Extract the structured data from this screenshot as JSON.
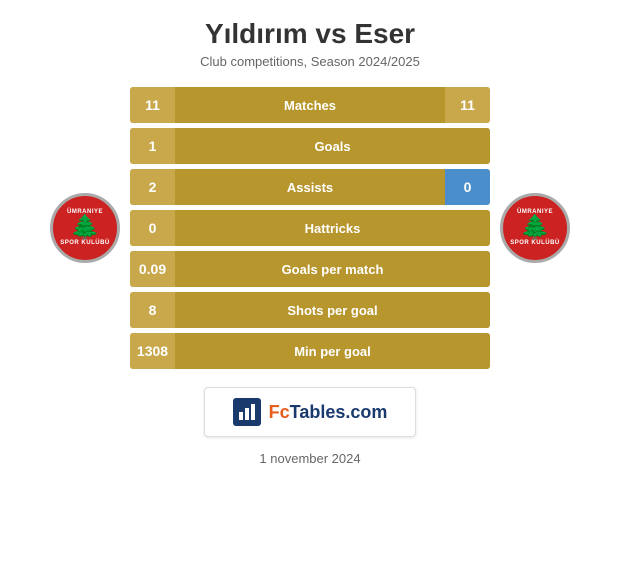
{
  "header": {
    "title": "Yıldırım vs Eser",
    "subtitle": "Club competitions, Season 2024/2025"
  },
  "stats": [
    {
      "label": "Matches",
      "left_val": "11",
      "right_val": "11",
      "type": "both"
    },
    {
      "label": "Goals",
      "left_val": "1",
      "right_val": "",
      "type": "left-only"
    },
    {
      "label": "Assists",
      "left_val": "2",
      "right_val": "0",
      "type": "assists"
    },
    {
      "label": "Hattricks",
      "left_val": "0",
      "right_val": "",
      "type": "left-only"
    },
    {
      "label": "Goals per match",
      "left_val": "0.09",
      "right_val": "",
      "type": "left-only"
    },
    {
      "label": "Shots per goal",
      "left_val": "8",
      "right_val": "",
      "type": "left-only"
    },
    {
      "label": "Min per goal",
      "left_val": "1308",
      "right_val": "",
      "type": "left-only"
    }
  ],
  "banner": {
    "text_fc": "Fc",
    "text_tables": "Tables.com"
  },
  "footer": {
    "date": "1 november 2024"
  },
  "logo_left_top": "ÜMRANIYE",
  "logo_left_bottom": "SPOR KULÜBÜ",
  "logo_right_top": "ÜMRANIYE",
  "logo_right_bottom": "SPOR KULÜBÜ"
}
